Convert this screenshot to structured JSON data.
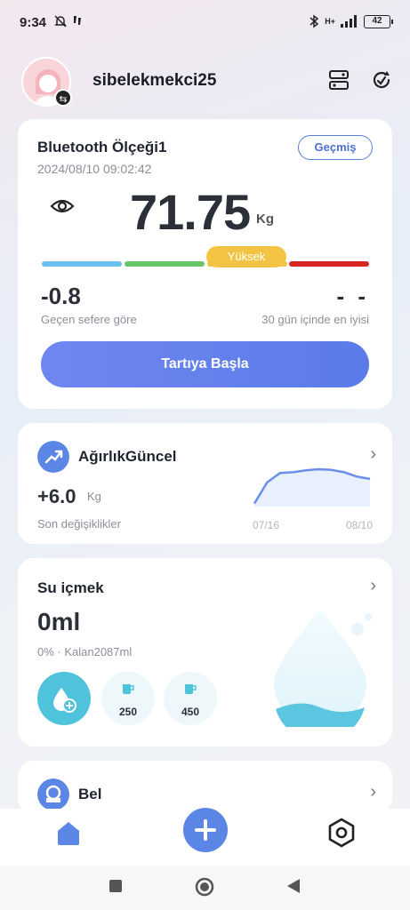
{
  "status_bar": {
    "time": "9:34",
    "battery": "42",
    "network": "H+"
  },
  "header": {
    "username": "sibelekmekci25",
    "icons": [
      "avatar",
      "swap-icon",
      "device-list-icon",
      "refresh-icon"
    ]
  },
  "scale_card": {
    "device_name": "Bluetooth Ölçeği1",
    "timestamp": "2024/08/10 09:02:42",
    "history_label": "Geçmiş",
    "weight": "71.75",
    "unit": "Kg",
    "level_label": "Yüksek",
    "level_colors": [
      "#6cc0ef",
      "#6bc46a",
      "#f3c443",
      "#d62626"
    ],
    "diff_value": "-0.8",
    "diff_label": "Geçen sefere göre",
    "best_value": "- -",
    "best_label": "30 gün içinde en iyisi",
    "start_button": "Tartıya Başla"
  },
  "weight_trend_card": {
    "title": "AğırlıkGüncel",
    "change_value": "+6.0",
    "change_unit": "Kg",
    "change_label": "Son değişiklikler",
    "chart_start_label": "07/16",
    "chart_end_label": "08/10",
    "trend_line": [
      0.08,
      0.65,
      0.9,
      0.92,
      0.97,
      1.0,
      0.98,
      0.92,
      0.8,
      0.74
    ]
  },
  "water_card": {
    "title": "Su içmek",
    "amount": "0ml",
    "progress": "0% · Kalan2087ml",
    "cup_small": "250",
    "cup_large": "450"
  },
  "waist_card": {
    "title": "Bel"
  },
  "tab_bar": {
    "items": [
      "home-icon",
      "add-icon",
      "settings-icon"
    ]
  }
}
